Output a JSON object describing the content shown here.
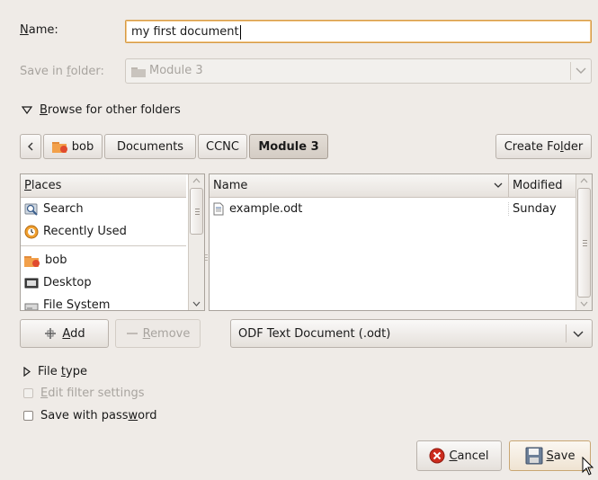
{
  "name_field": {
    "label_underlined": "N",
    "label_rest": "ame:",
    "value": "my first document"
  },
  "save_in": {
    "label_prefix": "Save in ",
    "label_underlined": "f",
    "label_suffix": "older:",
    "value": "Module 3"
  },
  "browse_toggle": {
    "label_underlined": "B",
    "label_rest": "rowse for other folders"
  },
  "path_bar": {
    "segments": [
      "bob",
      "Documents",
      "CCNC",
      "Module 3"
    ],
    "active": "Module 3",
    "create_folder": {
      "prefix": "Create Fo",
      "underlined": "l",
      "suffix": "der"
    }
  },
  "places": {
    "header_underlined": "P",
    "header_rest": "laces",
    "items": [
      {
        "label": "Search",
        "icon": "search-icon"
      },
      {
        "label": "Recently Used",
        "icon": "recent-icon"
      },
      {
        "label": "bob",
        "icon": "home-folder-icon"
      },
      {
        "label": "Desktop",
        "icon": "desktop-icon"
      },
      {
        "label": "File System",
        "icon": "drive-icon"
      }
    ],
    "add": {
      "underlined": "A",
      "rest": "dd"
    },
    "remove": {
      "underlined": "R",
      "rest": "emove"
    }
  },
  "files": {
    "columns": [
      "Name",
      "Modified"
    ],
    "rows": [
      {
        "name": "example.odt",
        "modified": "Sunday",
        "icon": "document-icon"
      }
    ]
  },
  "filter": {
    "value": "ODF Text Document (.odt)"
  },
  "file_type": {
    "prefix": "File ",
    "underlined": "t",
    "suffix": "ype"
  },
  "edit_filter": {
    "underlined": "E",
    "rest": "dit filter settings"
  },
  "save_password": {
    "prefix": "Save with pass",
    "underlined": "w",
    "suffix": "ord"
  },
  "buttons": {
    "cancel": {
      "underlined": "C",
      "rest": "ancel"
    },
    "save": {
      "underlined": "S",
      "rest": "ave"
    }
  },
  "colors": {
    "accent": "#d59a45",
    "background": "#efebe7",
    "cancel_red": "#cc2b1d"
  }
}
